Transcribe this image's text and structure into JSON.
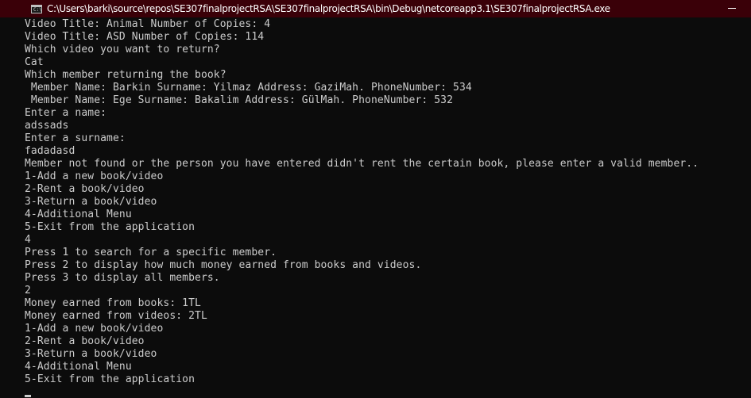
{
  "window": {
    "title": "C:\\Users\\barki\\source\\repos\\SE307finalprojectRSA\\SE307finalprojectRSA\\bin\\Debug\\netcoreapp3.1\\SE307finalprojectRSA.exe",
    "icon": "console-icon",
    "icon_glyph": "C:\\",
    "titlebar_color": "#3a0008"
  },
  "console": {
    "text_color": "#cccccc",
    "background": "#0c0c0c",
    "lines": [
      "Video Title: Animal Number of Copies: 4",
      "Video Title: ASD Number of Copies: 114",
      "Which video you want to return?",
      "Cat",
      "Which member returning the book?",
      " Member Name: Barkin Surname: Yilmaz Address: GaziMah. PhoneNumber: 534",
      " Member Name: Ege Surname: Bakalim Address: GülMah. PhoneNumber: 532",
      "Enter a name:",
      "adssads",
      "Enter a surname:",
      "fadadasd",
      "Member not found or the person you have entered didn't rent the certain book, please enter a valid member..",
      "1-Add a new book/video",
      "2-Rent a book/video",
      "3-Return a book/video",
      "4-Additional Menu",
      "5-Exit from the application",
      "4",
      "Press 1 to search for a specific member.",
      "Press 2 to display how much money earned from books and videos.",
      "Press 3 to display all members.",
      "2",
      "Money earned from books: 1TL",
      "Money earned from videos: 2TL",
      "1-Add a new book/video",
      "2-Rent a book/video",
      "3-Return a book/video",
      "4-Additional Menu",
      "5-Exit from the application"
    ]
  }
}
